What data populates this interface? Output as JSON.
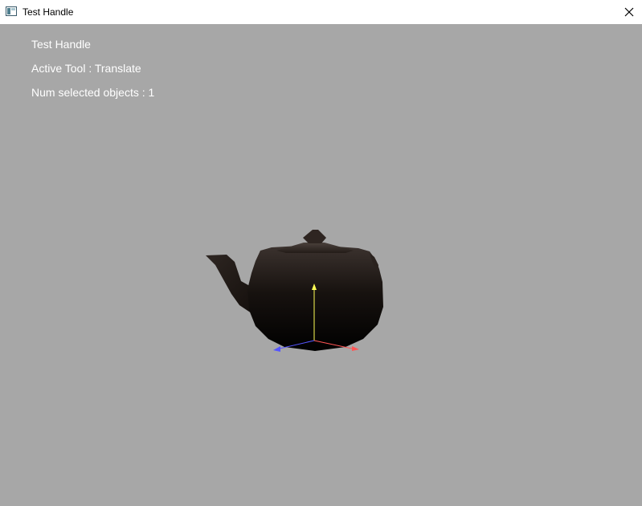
{
  "window": {
    "title": "Test Handle",
    "icon": "app-window-icon",
    "close_icon": "close-icon"
  },
  "viewport": {
    "background": "#a7a7a7",
    "overlay": {
      "title": "Test Handle",
      "active_tool": "Active Tool : Translate",
      "selection": "Num selected objects : 1"
    },
    "gizmo_colors": {
      "x_axis": "#ff4040",
      "y_axis": "#ffff40",
      "z_axis": "#4040ff"
    }
  }
}
